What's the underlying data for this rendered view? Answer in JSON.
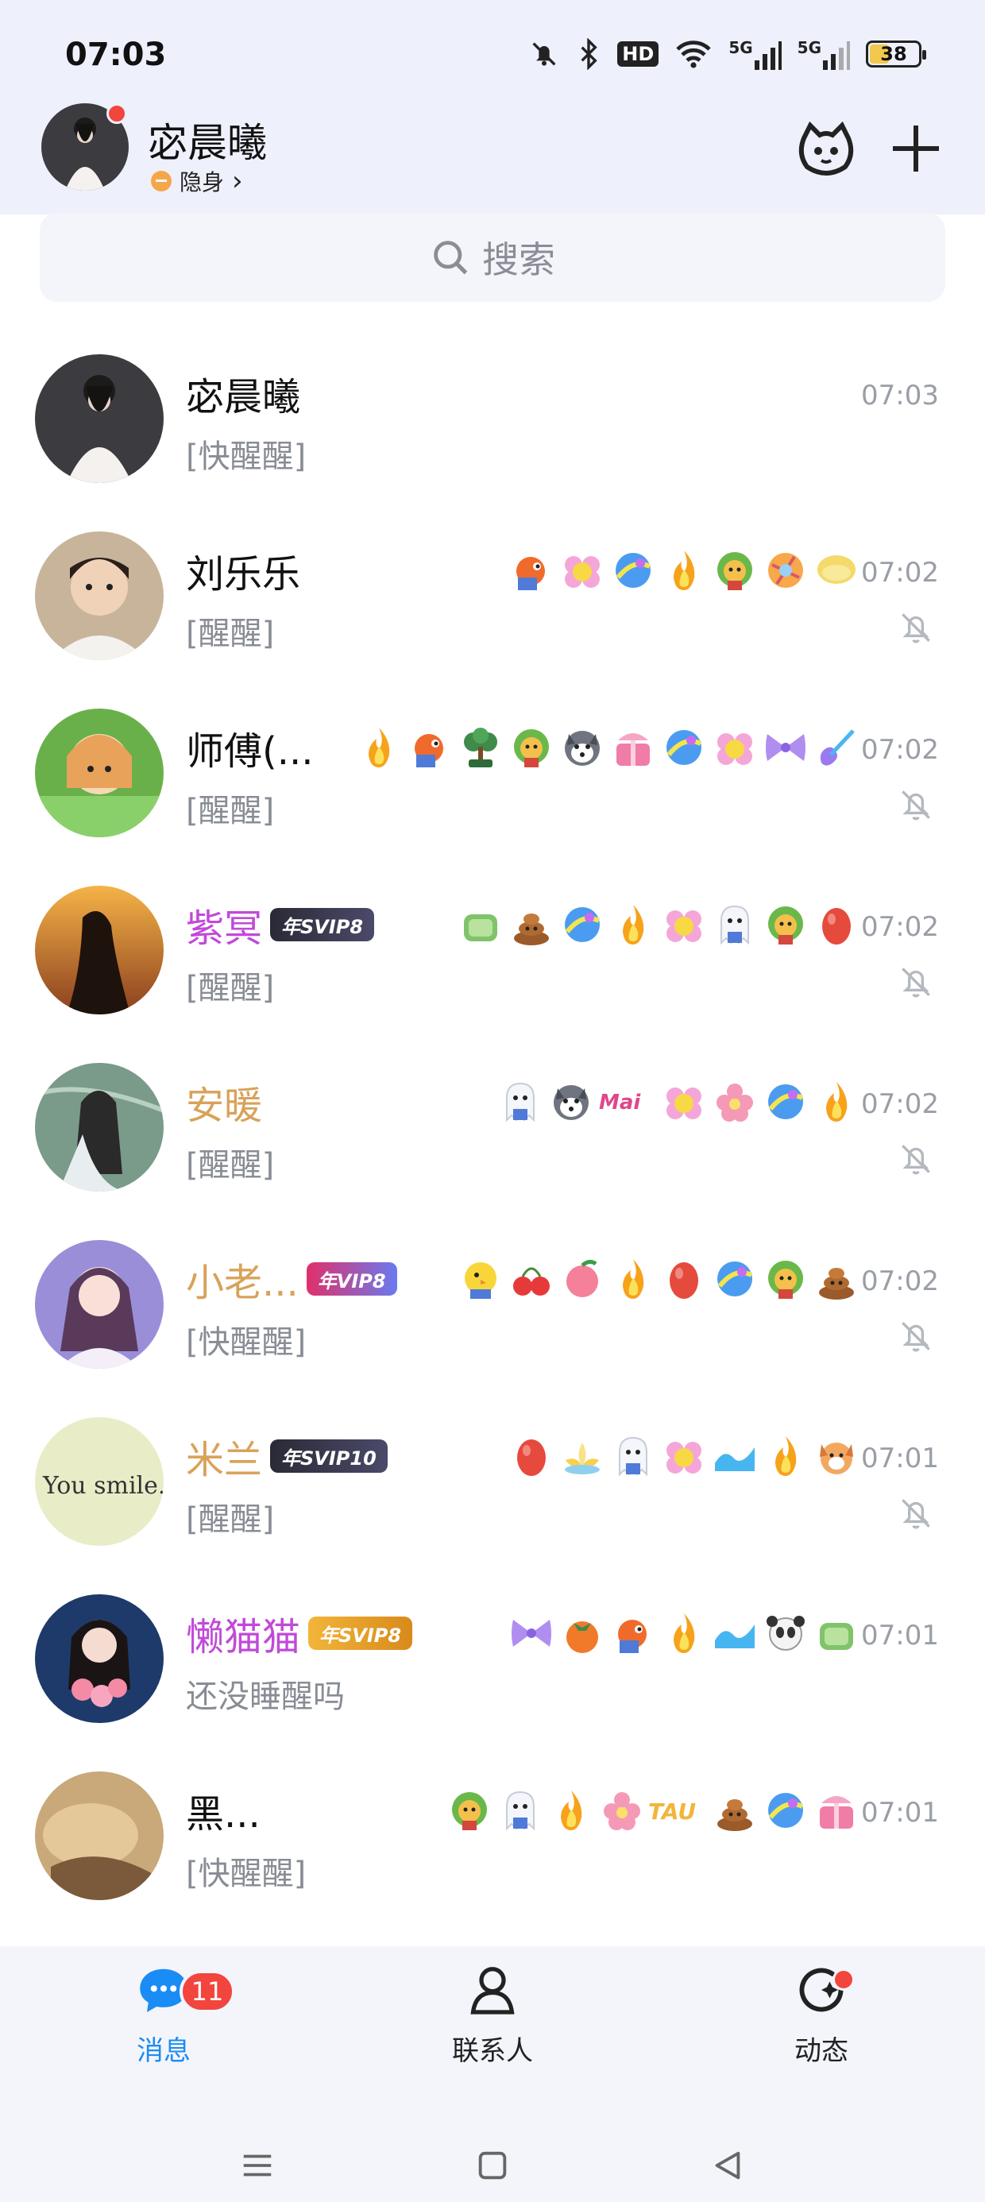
{
  "status_bar": {
    "time": "07:03",
    "icons": [
      "bell-off-icon",
      "bluetooth-icon",
      "hd-icon",
      "wifi-icon",
      "signal-5g-icon",
      "signal-5g-icon"
    ],
    "hd_label": "HD",
    "net_label": "5G",
    "battery": "38"
  },
  "profile": {
    "name": "宓晨曦",
    "status": "隐身",
    "status_arrow": "›"
  },
  "search": {
    "placeholder": "搜索"
  },
  "conversations": [
    {
      "name": "宓晨曦",
      "preview": "[快醒醒]",
      "time": "07:03",
      "name_color": "#111111",
      "muted": false,
      "badge": "",
      "emojis": []
    },
    {
      "name": "刘乐乐",
      "preview": "[醒醒]",
      "time": "07:02",
      "name_color": "#111111",
      "muted": true,
      "badge": "",
      "emojis": [
        "fish",
        "flower",
        "planet",
        "fire",
        "lion",
        "ball",
        "bread"
      ]
    },
    {
      "name": "师傅(...",
      "preview": "[醒醒]",
      "time": "07:02",
      "name_color": "#111111",
      "muted": true,
      "badge": "",
      "emojis": [
        "fire",
        "fish",
        "bonsai",
        "lion",
        "husky",
        "gift",
        "planet",
        "flower",
        "bow",
        "guitar"
      ]
    },
    {
      "name": "紫冥",
      "preview": "[醒醒]",
      "time": "07:02",
      "name_color": "#c04ad8",
      "muted": true,
      "badge": "年SVIP8",
      "emojis": [
        "cake",
        "poop",
        "planet",
        "fire",
        "flower",
        "ghost",
        "lion",
        "egg"
      ]
    },
    {
      "name": "安暖",
      "preview": "[醒醒]",
      "time": "07:02",
      "name_color": "#d8a25a",
      "muted": true,
      "badge": "",
      "emojis": [
        "ghost",
        "husky",
        "mai",
        "flower",
        "blossom",
        "planet",
        "fire"
      ]
    },
    {
      "name": "小老...",
      "preview": "[快醒醒]",
      "time": "07:02",
      "name_color": "#d8a25a",
      "muted": true,
      "badge": "年VIP8",
      "emojis": [
        "chick",
        "cherry",
        "peach",
        "fire",
        "egg",
        "planet",
        "lion",
        "poop"
      ]
    },
    {
      "name": "米兰",
      "preview": "[醒醒]",
      "time": "07:01",
      "name_color": "#d8a25a",
      "muted": true,
      "badge": "年SVIP10",
      "emojis": [
        "egg",
        "lotus",
        "ghost",
        "flower",
        "wave",
        "fire",
        "dog"
      ]
    },
    {
      "name": "懒猫猫",
      "preview": "还没睡醒吗",
      "time": "07:01",
      "name_color": "#c04ad8",
      "muted": false,
      "badge": "年SVIP8",
      "emojis": [
        "bow",
        "persimmon",
        "fish",
        "fire",
        "wave",
        "panda",
        "cake"
      ]
    },
    {
      "name": "黑...",
      "preview": "[快醒醒]",
      "time": "07:01",
      "name_color": "#111111",
      "muted": false,
      "badge": "",
      "emojis": [
        "lion",
        "ghost",
        "fire",
        "blossom",
        "tau",
        "poop",
        "planet",
        "gift"
      ]
    }
  ],
  "tabs": [
    {
      "label": "消息",
      "badge": "11",
      "active": true
    },
    {
      "label": "联系人",
      "active": false
    },
    {
      "label": "动态",
      "active": false
    }
  ],
  "colors": {
    "accent": "#1a8cf5",
    "badge_red": "#f2453d",
    "muted_gray": "#b4b8bf"
  }
}
